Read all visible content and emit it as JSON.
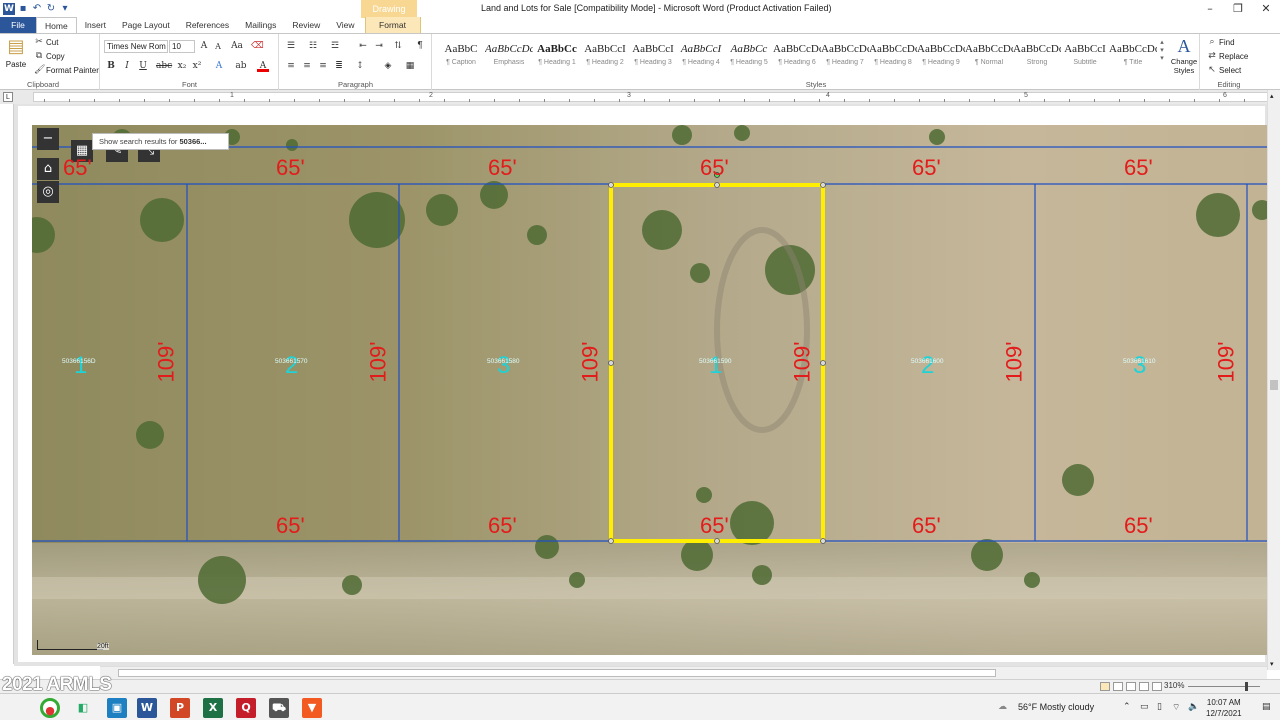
{
  "titlebar": {
    "title": "Land and Lots for Sale [Compatibility Mode]  -  Microsoft Word (Product Activation Failed)",
    "context_group": "Drawing Tools"
  },
  "tabs": [
    "File",
    "Home",
    "Insert",
    "Page Layout",
    "References",
    "Mailings",
    "Review",
    "View",
    "Format"
  ],
  "ribbon": {
    "clipboard": {
      "paste": "Paste",
      "cut": "Cut",
      "copy": "Copy",
      "format_painter": "Format Painter",
      "label": "Clipboard"
    },
    "font": {
      "font_name": "Times New Rom",
      "font_size": "10",
      "bold": "B",
      "italic": "I",
      "underline": "U",
      "label": "Font"
    },
    "paragraph": {
      "label": "Paragraph"
    },
    "styles": {
      "items": [
        {
          "sample": "AaBbC",
          "name": "¶ Caption"
        },
        {
          "sample": "AaBbCcDc",
          "name": "Emphasis"
        },
        {
          "sample": "AaBbCc",
          "name": "¶ Heading 1"
        },
        {
          "sample": "AaBbCcI",
          "name": "¶ Heading 2"
        },
        {
          "sample": "AaBbCcI",
          "name": "¶ Heading 3"
        },
        {
          "sample": "AaBbCcI",
          "name": "¶ Heading 4"
        },
        {
          "sample": "AaBbCc",
          "name": "¶ Heading 5"
        },
        {
          "sample": "AaBbCcDc",
          "name": "¶ Heading 6"
        },
        {
          "sample": "AaBbCcDc",
          "name": "¶ Heading 7"
        },
        {
          "sample": "AaBbCcDc",
          "name": "¶ Heading 8"
        },
        {
          "sample": "AaBbCcDc",
          "name": "¶ Heading 9"
        },
        {
          "sample": "AaBbCcDc",
          "name": "¶ Normal"
        },
        {
          "sample": "AaBbCcDd",
          "name": "Strong"
        },
        {
          "sample": "AaBbCcI",
          "name": "Subtitle"
        },
        {
          "sample": "AaBbCcDdI",
          "name": "¶ Title"
        }
      ],
      "change_styles": "Change Styles",
      "label": "Styles"
    },
    "editing": {
      "find": "Find",
      "replace": "Replace",
      "select": "Select",
      "label": "Editing"
    }
  },
  "ruler": {
    "numbers": [
      "1",
      "2",
      "3",
      "4",
      "5",
      "6"
    ]
  },
  "map": {
    "search_tooltip_prefix": "Show search results for ",
    "search_tooltip_query": "50366...",
    "top_dimensions": [
      "65'",
      "65'",
      "65'",
      "65'",
      "65'",
      "65'"
    ],
    "bottom_dimensions": [
      "65'",
      "65'",
      "65'",
      "65'",
      "65'"
    ],
    "side_dimensions": [
      "109'",
      "109'",
      "109'",
      "109'",
      "109'",
      "109'"
    ],
    "lot_numbers": [
      "1",
      "2",
      "3",
      "1",
      "2",
      "3"
    ],
    "parcel_ids": [
      "50366156D",
      "503661570",
      "503661580",
      "503661590",
      "503661600",
      "503661610"
    ],
    "scale_label": "20ft",
    "highlight_color": "#ffee00",
    "boundary_color": "#1f4fc4",
    "dimension_color": "#e31b1b"
  },
  "status": {
    "watermark": "2021 ARMLS",
    "zoom": "310%"
  },
  "taskbar": {
    "weather": "56°F  Mostly cloudy",
    "time": "10:07 AM",
    "date": "12/7/2021"
  }
}
